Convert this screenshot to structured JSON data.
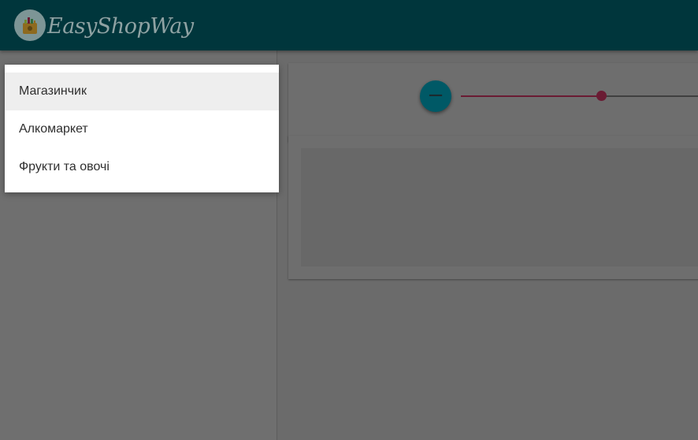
{
  "app": {
    "logo_text": "EasyShopWay",
    "colors": {
      "header": "#00363c",
      "accent": "#005966",
      "slider": "#6a1b33",
      "menu_background": "#ffffff",
      "menu_selected": "#eeeeee"
    }
  },
  "header": {
    "logo_icon": "shopping-basket-icon"
  },
  "controls": {
    "minus_button": {
      "icon": "minus-icon",
      "label": "−"
    },
    "slider": {
      "value_fraction": 0.54
    }
  },
  "menu": {
    "selected_index": 0,
    "items": [
      {
        "label": "Магазинчик"
      },
      {
        "label": "Алкомаркет"
      },
      {
        "label": "Фрукти та овочі"
      }
    ]
  }
}
